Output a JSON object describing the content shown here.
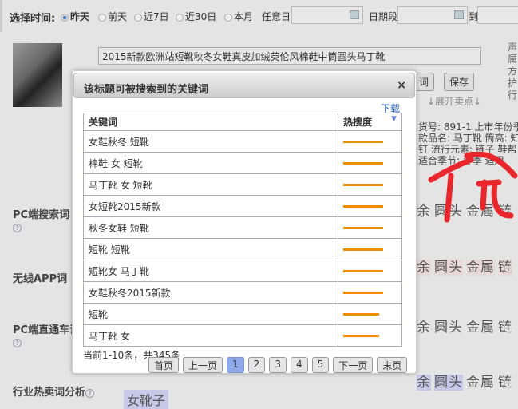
{
  "filter": {
    "label": "选择时间:",
    "options": [
      {
        "label": "昨天",
        "selected": true
      },
      {
        "label": "前天",
        "selected": false
      },
      {
        "label": "近7日",
        "selected": false
      },
      {
        "label": "近30日",
        "selected": false
      },
      {
        "label": "本月",
        "selected": false
      }
    ],
    "any_day_label": "任意日",
    "range_label": "日期段",
    "to_label": "到"
  },
  "product": {
    "title": "2015新款欧洲站短靴秋冬女鞋真皮加绒英伦风棉鞋中筒圆头马丁靴",
    "btn_word": "词",
    "btn_save": "保存",
    "expand": "↓展开卖点↓",
    "side_text": [
      "声",
      "属",
      "方",
      "护",
      "行"
    ],
    "attrs": [
      "货号: 891-1  上市年份季",
      "款品名: 马丁靴  筒高: 知",
      "钉  流行元素: 链子  鞋帮",
      "适合季节: 冬季  适用"
    ]
  },
  "sections": [
    {
      "label": "PC端搜索词",
      "help": "?"
    },
    {
      "label": "无线APP词",
      "help": ""
    },
    {
      "label": "PC端直通车词",
      "help": "?"
    },
    {
      "label": "行业热卖词分析",
      "help": "?"
    }
  ],
  "tags": [
    "余",
    "圆头",
    "金属",
    "链"
  ],
  "bottom_tag": "女靴子",
  "annotation": "优",
  "modal": {
    "title": "该标题可被搜索到的关键词",
    "close": "×",
    "download": "下载",
    "col_keyword": "关键词",
    "col_heat": "热搜度",
    "rows": [
      {
        "keyword": "女鞋秋冬 短靴",
        "heat": 100
      },
      {
        "keyword": "棉鞋 女 短靴",
        "heat": 100
      },
      {
        "keyword": "马丁靴 女 短靴",
        "heat": 100
      },
      {
        "keyword": "女短靴2015新款",
        "heat": 100
      },
      {
        "keyword": "秋冬女鞋 短靴",
        "heat": 100
      },
      {
        "keyword": "短靴 短靴",
        "heat": 100
      },
      {
        "keyword": "短靴女 马丁靴",
        "heat": 100
      },
      {
        "keyword": "女鞋秋冬2015新款",
        "heat": 100
      },
      {
        "keyword": "短靴",
        "heat": 90
      },
      {
        "keyword": "马丁靴 女",
        "heat": 90
      }
    ],
    "page_info": "当前1-10条，共345条",
    "pager": {
      "first": "首页",
      "prev": "上一页",
      "pages": [
        "1",
        "2",
        "3",
        "4",
        "5"
      ],
      "current": "1",
      "next": "下一页",
      "last": "末页"
    }
  },
  "colors": {
    "heat": "#f08c00",
    "annotation": "#e8262b",
    "current_page": "#8ea8ec"
  }
}
